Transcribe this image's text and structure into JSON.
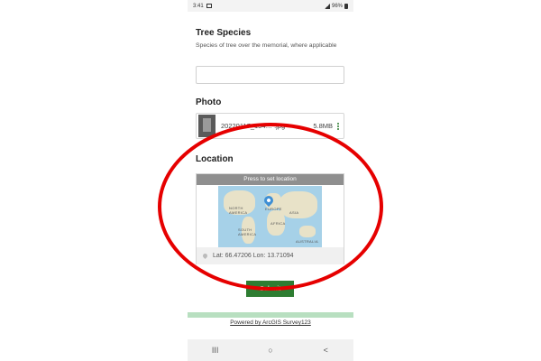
{
  "status_bar": {
    "time": "3:41",
    "battery": "96%"
  },
  "tree_species": {
    "title": "Tree Species",
    "description": "Species of tree over the memorial, where applicable",
    "value": ""
  },
  "photo": {
    "title": "Photo",
    "file_name": "20220117_154… .jpg",
    "file_size": "5.8MB"
  },
  "location": {
    "title": "Location",
    "map_prompt": "Press to set location",
    "coordinates": "Lat: 66.47206 Lon: 13.71094",
    "map_labels": [
      "NORTH AMERICA",
      "EUROPE",
      "ASIA",
      "AFRICA",
      "SOUTH AMERICA",
      "AUSTRALIA"
    ]
  },
  "submit_label": "Submit",
  "powered_by": "Powered by ArcGIS Survey123",
  "nav": {
    "recents": "III",
    "home": "○",
    "back": "<"
  },
  "colors": {
    "accent_green": "#2e7d32",
    "annotation_red": "#e60000",
    "map_water": "#a6d1e8"
  },
  "icons": [
    "gallery-icon",
    "signal-icon",
    "battery-icon",
    "more-icon",
    "map-pin-icon",
    "location-icon"
  ]
}
